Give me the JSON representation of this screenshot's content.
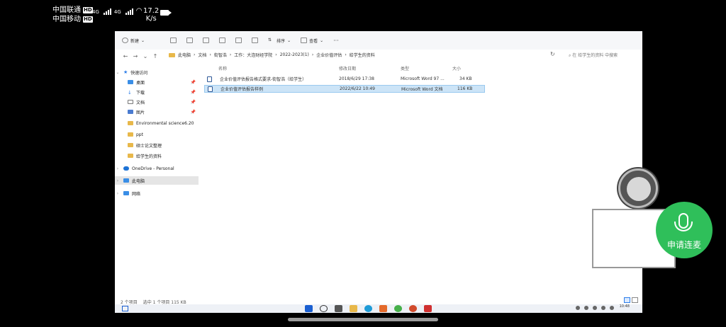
{
  "phone_status": {
    "carrier1": "中国联通",
    "carrier2": "中国移动",
    "hd": "HD",
    "net1": "4G",
    "net2": "4G",
    "speed_value": "17.2",
    "speed_unit": "K/s"
  },
  "cmdbar": {
    "new": "新建",
    "sort": "排序",
    "view": "查看",
    "more": "···"
  },
  "address": {
    "crumbs": [
      "此电脑",
      "文档",
      "街智浩",
      "工作：大连财经学院",
      "2022-2023(1)",
      "企业价值评估",
      "给学生的资料"
    ],
    "search_placeholder": "在 给学生的资料 中搜索"
  },
  "sidebar": {
    "quick_access": "快速访问",
    "items": [
      {
        "label": "桌面",
        "pinned": true
      },
      {
        "label": "下载",
        "pinned": true
      },
      {
        "label": "文档",
        "pinned": true
      },
      {
        "label": "图片",
        "pinned": true
      },
      {
        "label": "Environmental science6.20",
        "pinned": false
      },
      {
        "label": "ppt",
        "pinned": false
      },
      {
        "label": "硕士论文整理",
        "pinned": false
      },
      {
        "label": "给学生的资料",
        "pinned": false
      }
    ],
    "onedrive": "OneDrive - Personal",
    "this_pc": "此电脑",
    "network": "网络"
  },
  "columns": {
    "name": "名称",
    "modified": "修改日期",
    "type": "类型",
    "size": "大小"
  },
  "files": [
    {
      "name": "企业价值评估报告格式要求-街智浩（给学生）",
      "modified": "2018/6/29 17:38",
      "type": "Microsoft Word 97 ...",
      "size": "34 KB"
    },
    {
      "name": "企业价值评估报告样例",
      "modified": "2022/6/22 10:49",
      "type": "Microsoft Word 文档",
      "size": "116 KB"
    }
  ],
  "statusbar": {
    "count": "2 个项目",
    "selected": "选中 1 个项目  115 KB"
  },
  "clock": {
    "time": "10:48"
  },
  "overlay": {
    "mic_label": "申请连麦"
  },
  "colors": {
    "accent": "#2fbf5a",
    "selection": "#cce4f7"
  }
}
